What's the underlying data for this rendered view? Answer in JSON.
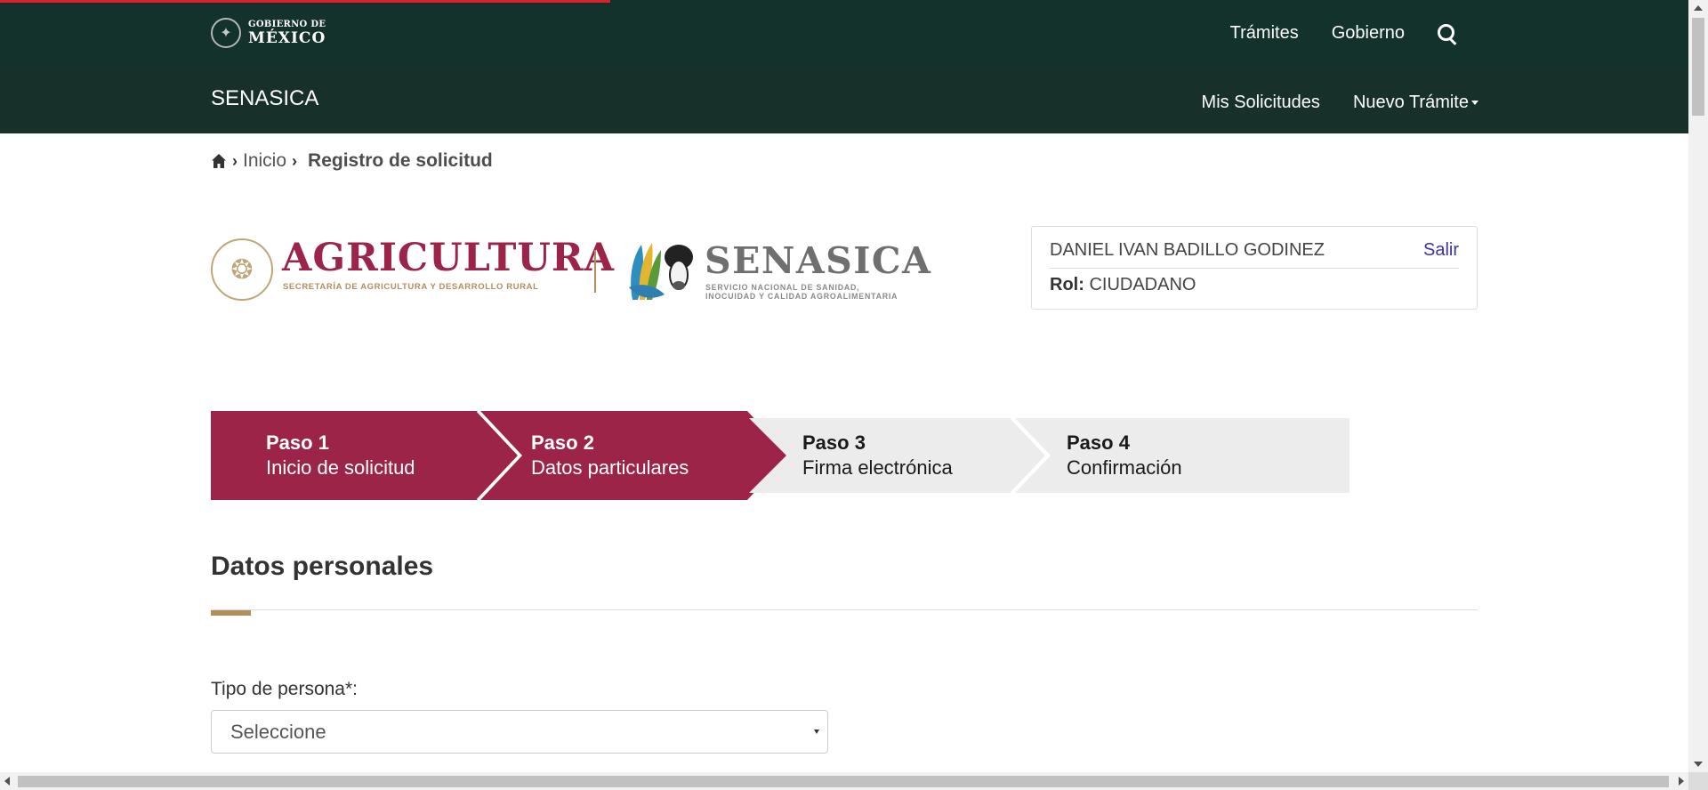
{
  "gov_header": {
    "logo_line1": "GOBIERNO DE",
    "logo_line2": "MÉXICO",
    "nav": [
      {
        "label": "Trámites"
      },
      {
        "label": "Gobierno"
      }
    ],
    "search_icon": "search-icon"
  },
  "app_header": {
    "title": "SENASICA",
    "nav": [
      {
        "label": "Mis Solicitudes"
      },
      {
        "label": "Nuevo Trámite"
      }
    ]
  },
  "breadcrumb": {
    "home_icon": "home-icon",
    "items": [
      {
        "label": "Inicio"
      },
      {
        "label": "Registro de solicitud"
      }
    ]
  },
  "institution": {
    "agri_title": "AGRICULTURA",
    "agri_subtitle": "SECRETARÍA DE AGRICULTURA Y DESARROLLO RURAL",
    "senasica_title": "SENASICA",
    "senasica_sub1": "SERVICIO NACIONAL DE SANIDAD,",
    "senasica_sub2": "INOCUIDAD Y CALIDAD AGROALIMENTARIA"
  },
  "user": {
    "name": "DANIEL IVAN BADILLO GODINEZ",
    "logout_label": "Salir",
    "role_label": "Rol:",
    "role_value": "CIUDADANO"
  },
  "stepper": {
    "colors": {
      "active": "#9d2449",
      "inactive": "#ececec"
    },
    "steps": [
      {
        "num": "Paso 1",
        "label": "Inicio de solicitud",
        "state": "active"
      },
      {
        "num": "Paso 2",
        "label": "Datos particulares",
        "state": "active"
      },
      {
        "num": "Paso 3",
        "label": "Firma electrónica",
        "state": "inactive"
      },
      {
        "num": "Paso 4",
        "label": "Confirmación",
        "state": "inactive"
      }
    ]
  },
  "form": {
    "section_title": "Datos personales",
    "person_type_label": "Tipo de persona*:",
    "person_type_value": "Seleccione"
  },
  "colors": {
    "gov_dark": "#13322b",
    "brand_maroon": "#9d2449",
    "brand_gold": "#b38e5d",
    "link_blue": "#3a35a5"
  }
}
